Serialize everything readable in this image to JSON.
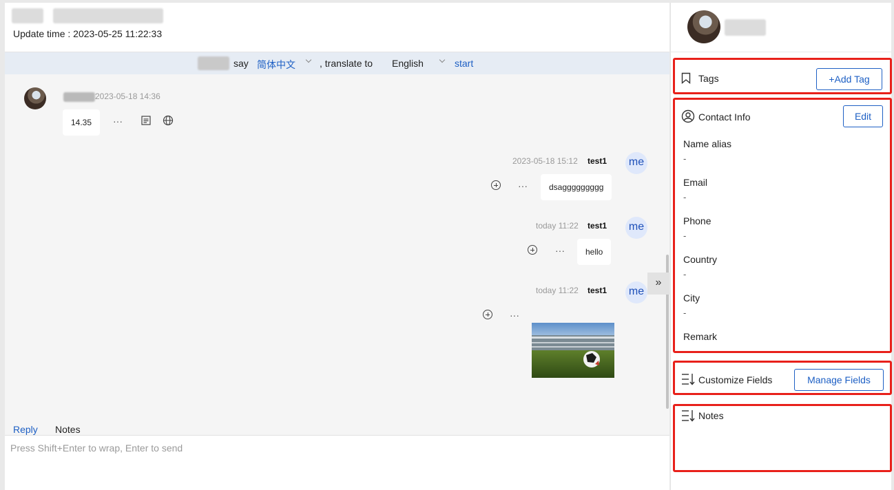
{
  "chat": {
    "update_time": "Update time : 2023-05-25 11:22:33",
    "translate": {
      "say": "say",
      "from_lang": "简体中文",
      "translate_to": ", translate to",
      "to_lang": "English",
      "start": "start"
    },
    "messages": [
      {
        "side": "incoming",
        "time": "2023-05-18 14:36",
        "text": "14.35"
      },
      {
        "side": "outgoing",
        "time": "2023-05-18 15:12",
        "sender": "test1",
        "avatar": "me",
        "text": "dsaggggggggg"
      },
      {
        "side": "outgoing",
        "time": "today 11:22",
        "sender": "test1",
        "avatar": "me",
        "text": "hello"
      },
      {
        "side": "outgoing",
        "time": "today 11:22",
        "sender": "test1",
        "avatar": "me",
        "image": "stadium-soccer-ball"
      }
    ],
    "reply_tabs": [
      "Reply",
      "Notes"
    ],
    "reply_placeholder": "Press Shift+Enter to wrap, Enter to send",
    "dots": "···",
    "collapse_icon": "»"
  },
  "side": {
    "tags": {
      "title": "Tags",
      "button": "+Add Tag"
    },
    "contact_info": {
      "title": "Contact Info",
      "button": "Edit",
      "fields": [
        {
          "label": "Name alias",
          "value": "-"
        },
        {
          "label": "Email",
          "value": "-"
        },
        {
          "label": "Phone",
          "value": "-"
        },
        {
          "label": "Country",
          "value": "-"
        },
        {
          "label": "City",
          "value": "-"
        },
        {
          "label": "Remark",
          "value": ""
        }
      ]
    },
    "custom_fields": {
      "title": "Customize Fields",
      "button": "Manage Fields"
    },
    "notes": {
      "title": "Notes"
    }
  },
  "colors": {
    "accent": "#1d5fc4",
    "highlight": "#e8201a",
    "translate_bar": "#e6ecf4"
  }
}
